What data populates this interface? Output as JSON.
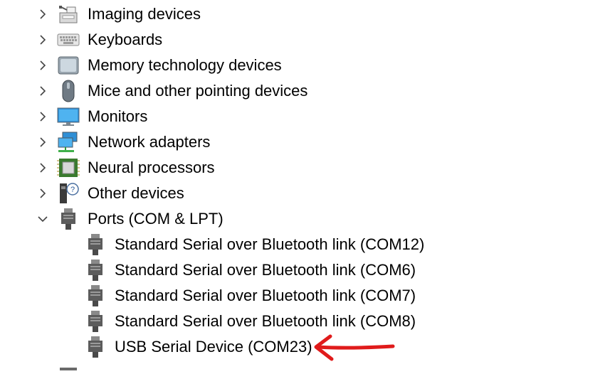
{
  "categories": [
    {
      "label": "Imaging devices",
      "expanded": false,
      "icon": "imaging-device-icon"
    },
    {
      "label": "Keyboards",
      "expanded": false,
      "icon": "keyboard-icon"
    },
    {
      "label": "Memory technology devices",
      "expanded": false,
      "icon": "memory-device-icon"
    },
    {
      "label": "Mice and other pointing devices",
      "expanded": false,
      "icon": "mouse-icon"
    },
    {
      "label": "Monitors",
      "expanded": false,
      "icon": "monitor-icon"
    },
    {
      "label": "Network adapters",
      "expanded": false,
      "icon": "network-adapter-icon"
    },
    {
      "label": "Neural processors",
      "expanded": false,
      "icon": "neural-processor-icon"
    },
    {
      "label": "Other devices",
      "expanded": false,
      "icon": "unknown-device-icon"
    },
    {
      "label": "Ports (COM & LPT)",
      "expanded": true,
      "icon": "port-icon"
    }
  ],
  "ports": [
    {
      "label": "Standard Serial over Bluetooth link (COM12)",
      "icon": "port-icon"
    },
    {
      "label": "Standard Serial over Bluetooth link (COM6)",
      "icon": "port-icon"
    },
    {
      "label": "Standard Serial over Bluetooth link (COM7)",
      "icon": "port-icon"
    },
    {
      "label": "Standard Serial over Bluetooth link (COM8)",
      "icon": "port-icon"
    },
    {
      "label": "USB Serial Device (COM23)",
      "icon": "port-icon"
    }
  ],
  "annotation": {
    "color": "#e01b1b",
    "icon": "red-arrow-annotation"
  }
}
